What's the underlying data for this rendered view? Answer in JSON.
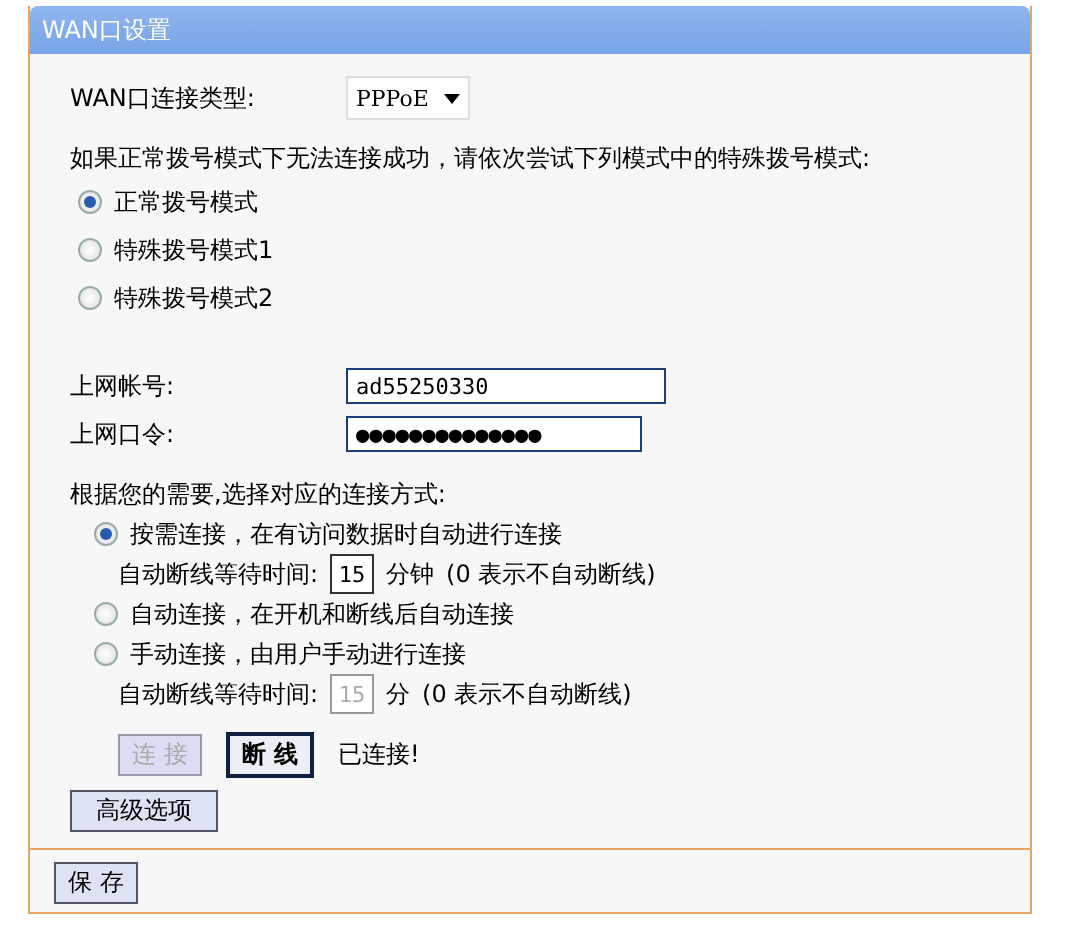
{
  "panel": {
    "title": "WAN口设置"
  },
  "wan_type": {
    "label": "WAN口连接类型:",
    "value": "PPPoE"
  },
  "dial_hint": "如果正常拨号模式下无法连接成功，请依次尝试下列模式中的特殊拨号模式:",
  "dial_modes": [
    {
      "label": "正常拨号模式",
      "selected": true
    },
    {
      "label": "特殊拨号模式1",
      "selected": false
    },
    {
      "label": "特殊拨号模式2",
      "selected": false
    }
  ],
  "account": {
    "label": "上网帐号:",
    "value": "ad55250330"
  },
  "password": {
    "label": "上网口令:",
    "value": "●●●●●●●●●●●●●●"
  },
  "connect_hint": "根据您的需要,选择对应的连接方式:",
  "connect_modes": [
    {
      "label": "按需连接，在有访问数据时自动进行连接",
      "selected": true,
      "wait": {
        "label": "自动断线等待时间:",
        "value": "15",
        "unit": "分钟",
        "note": "(0 表示不自动断线)",
        "disabled": false
      }
    },
    {
      "label": "自动连接，在开机和断线后自动连接",
      "selected": false
    },
    {
      "label": "手动连接，由用户手动进行连接",
      "selected": false,
      "wait": {
        "label": "自动断线等待时间:",
        "value": "15",
        "unit": "分",
        "note": "(0 表示不自动断线)",
        "disabled": true
      }
    }
  ],
  "actions": [
    {
      "label": "连 接",
      "disabled": true
    },
    {
      "label": "断 线",
      "disabled": false
    }
  ],
  "status": "已连接!",
  "advanced_button": "高级选项",
  "save_button": "保 存"
}
